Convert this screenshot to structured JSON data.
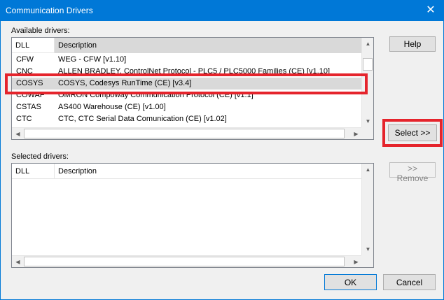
{
  "window": {
    "title": "Communication Drivers",
    "close_glyph": "✕"
  },
  "available": {
    "label": "Available drivers:",
    "columns": {
      "dll": "DLL",
      "description": "Description"
    },
    "rows": [
      {
        "dll": "CFW",
        "description": "WEG - CFW  [v1.10]"
      },
      {
        "dll": "CNC",
        "description": "ALLEN BRADLEY, ControlNet Protocol - PLC5 / PLC5000 Families (CE) [v1.10]"
      },
      {
        "dll": "COSYS",
        "description": "COSYS, Codesys RunTime (CE) [v3.4]"
      },
      {
        "dll": "COWAF",
        "description": "OMRON Compoway Communication Protocol (CE) [v1.1]"
      },
      {
        "dll": "CSTAS",
        "description": "AS400 Warehouse (CE) [v1.00]"
      },
      {
        "dll": "CTC",
        "description": "CTC,  CTC Serial Data Comunication (CE)  [v1.02]"
      }
    ]
  },
  "selected": {
    "label": "Selected drivers:",
    "columns": {
      "dll": "DLL",
      "description": "Description"
    }
  },
  "buttons": {
    "help": "Help",
    "select": "Select >>",
    "remove": ">> Remove",
    "ok": "OK",
    "cancel": "Cancel"
  },
  "icons": {
    "scroll_up": "▲",
    "scroll_down": "▼",
    "scroll_left": "◀",
    "scroll_right": "▶"
  },
  "colors": {
    "titlebar": "#0078d7",
    "highlight": "#e5242c",
    "selected_row": "#d9d9d9"
  }
}
